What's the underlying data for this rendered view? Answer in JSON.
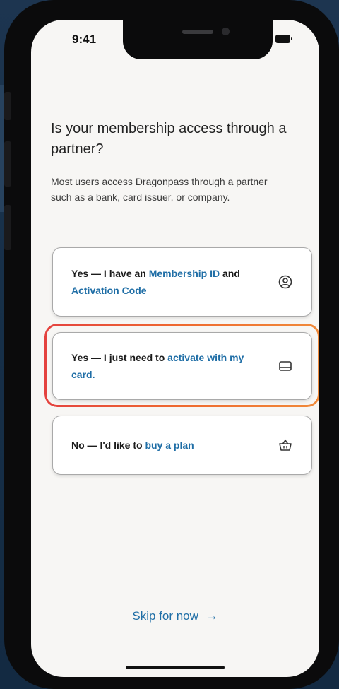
{
  "status_bar": {
    "time": "9:41"
  },
  "question": {
    "title": "Is your membership access through a partner?",
    "subtitle": "Most users access Dragonpass through a partner such as a bank, card issuer, or company."
  },
  "options": [
    {
      "prefix": "Yes — I have an ",
      "link1": "Membership ID",
      "middle": " and ",
      "link2": "Activation Code",
      "icon": "user-circle-icon"
    },
    {
      "prefix": "Yes — I just need to ",
      "link1": "activate with my card.",
      "icon": "card-icon",
      "highlighted": true
    },
    {
      "prefix": "No — I'd like to ",
      "link1": "buy a plan",
      "icon": "basket-icon"
    }
  ],
  "skip": {
    "label": "Skip for now",
    "arrow": "→"
  },
  "colors": {
    "accent": "#1f6ea6",
    "highlight": "#ec5a37",
    "background": "#f7f6f4"
  }
}
